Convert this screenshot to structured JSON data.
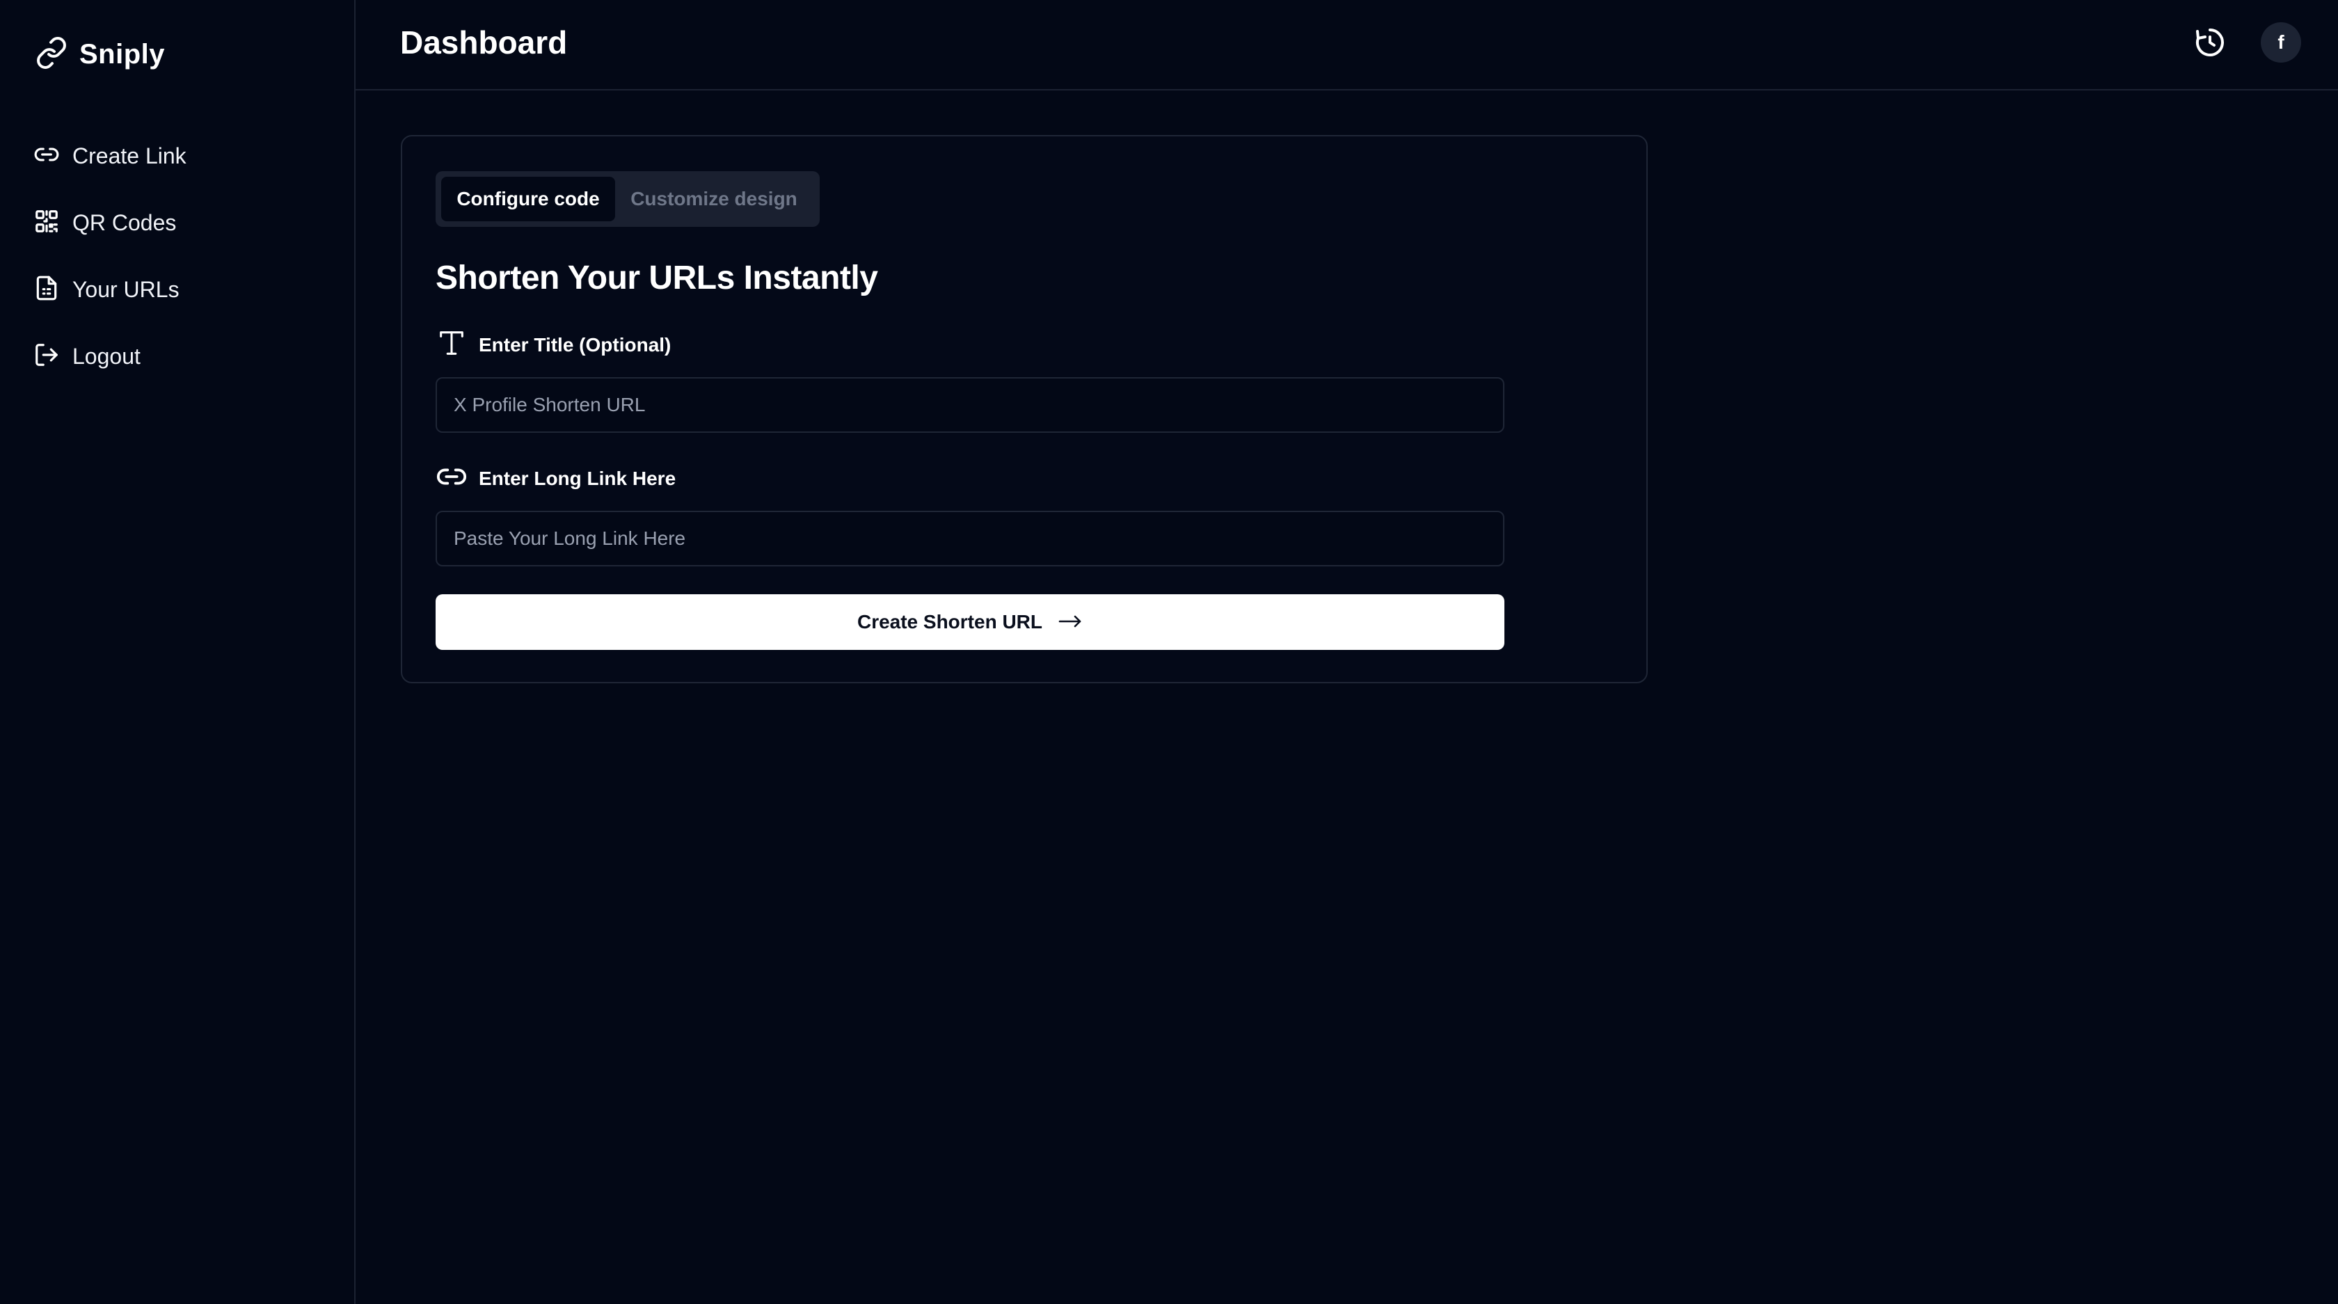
{
  "brand": {
    "name": "Sniply",
    "icon": "link-icon"
  },
  "sidebar": {
    "items": [
      {
        "label": "Create Link",
        "icon": "link-icon"
      },
      {
        "label": "QR Codes",
        "icon": "qr-code-icon"
      },
      {
        "label": "Your URLs",
        "icon": "document-icon"
      },
      {
        "label": "Logout",
        "icon": "logout-icon"
      }
    ]
  },
  "header": {
    "title": "Dashboard",
    "history_icon": "history-icon",
    "avatar_initial": "f"
  },
  "card": {
    "tabs": [
      {
        "label": "Configure code",
        "active": true
      },
      {
        "label": "Customize design",
        "active": false
      }
    ],
    "heading": "Shorten Your URLs Instantly",
    "title_field": {
      "label": "Enter Title (Optional)",
      "icon": "text-icon",
      "placeholder": "X Profile Shorten URL",
      "value": ""
    },
    "link_field": {
      "label": "Enter Long Link Here",
      "icon": "link-icon",
      "placeholder": "Paste Your Long Link Here",
      "value": ""
    },
    "submit": {
      "label": "Create Shorten URL",
      "icon": "arrow-right-icon"
    }
  },
  "colors": {
    "background": "#030816",
    "border": "#1f2636",
    "tab_bg": "#1a2030",
    "muted_text": "#6f7789",
    "button_bg": "#ffffff"
  }
}
